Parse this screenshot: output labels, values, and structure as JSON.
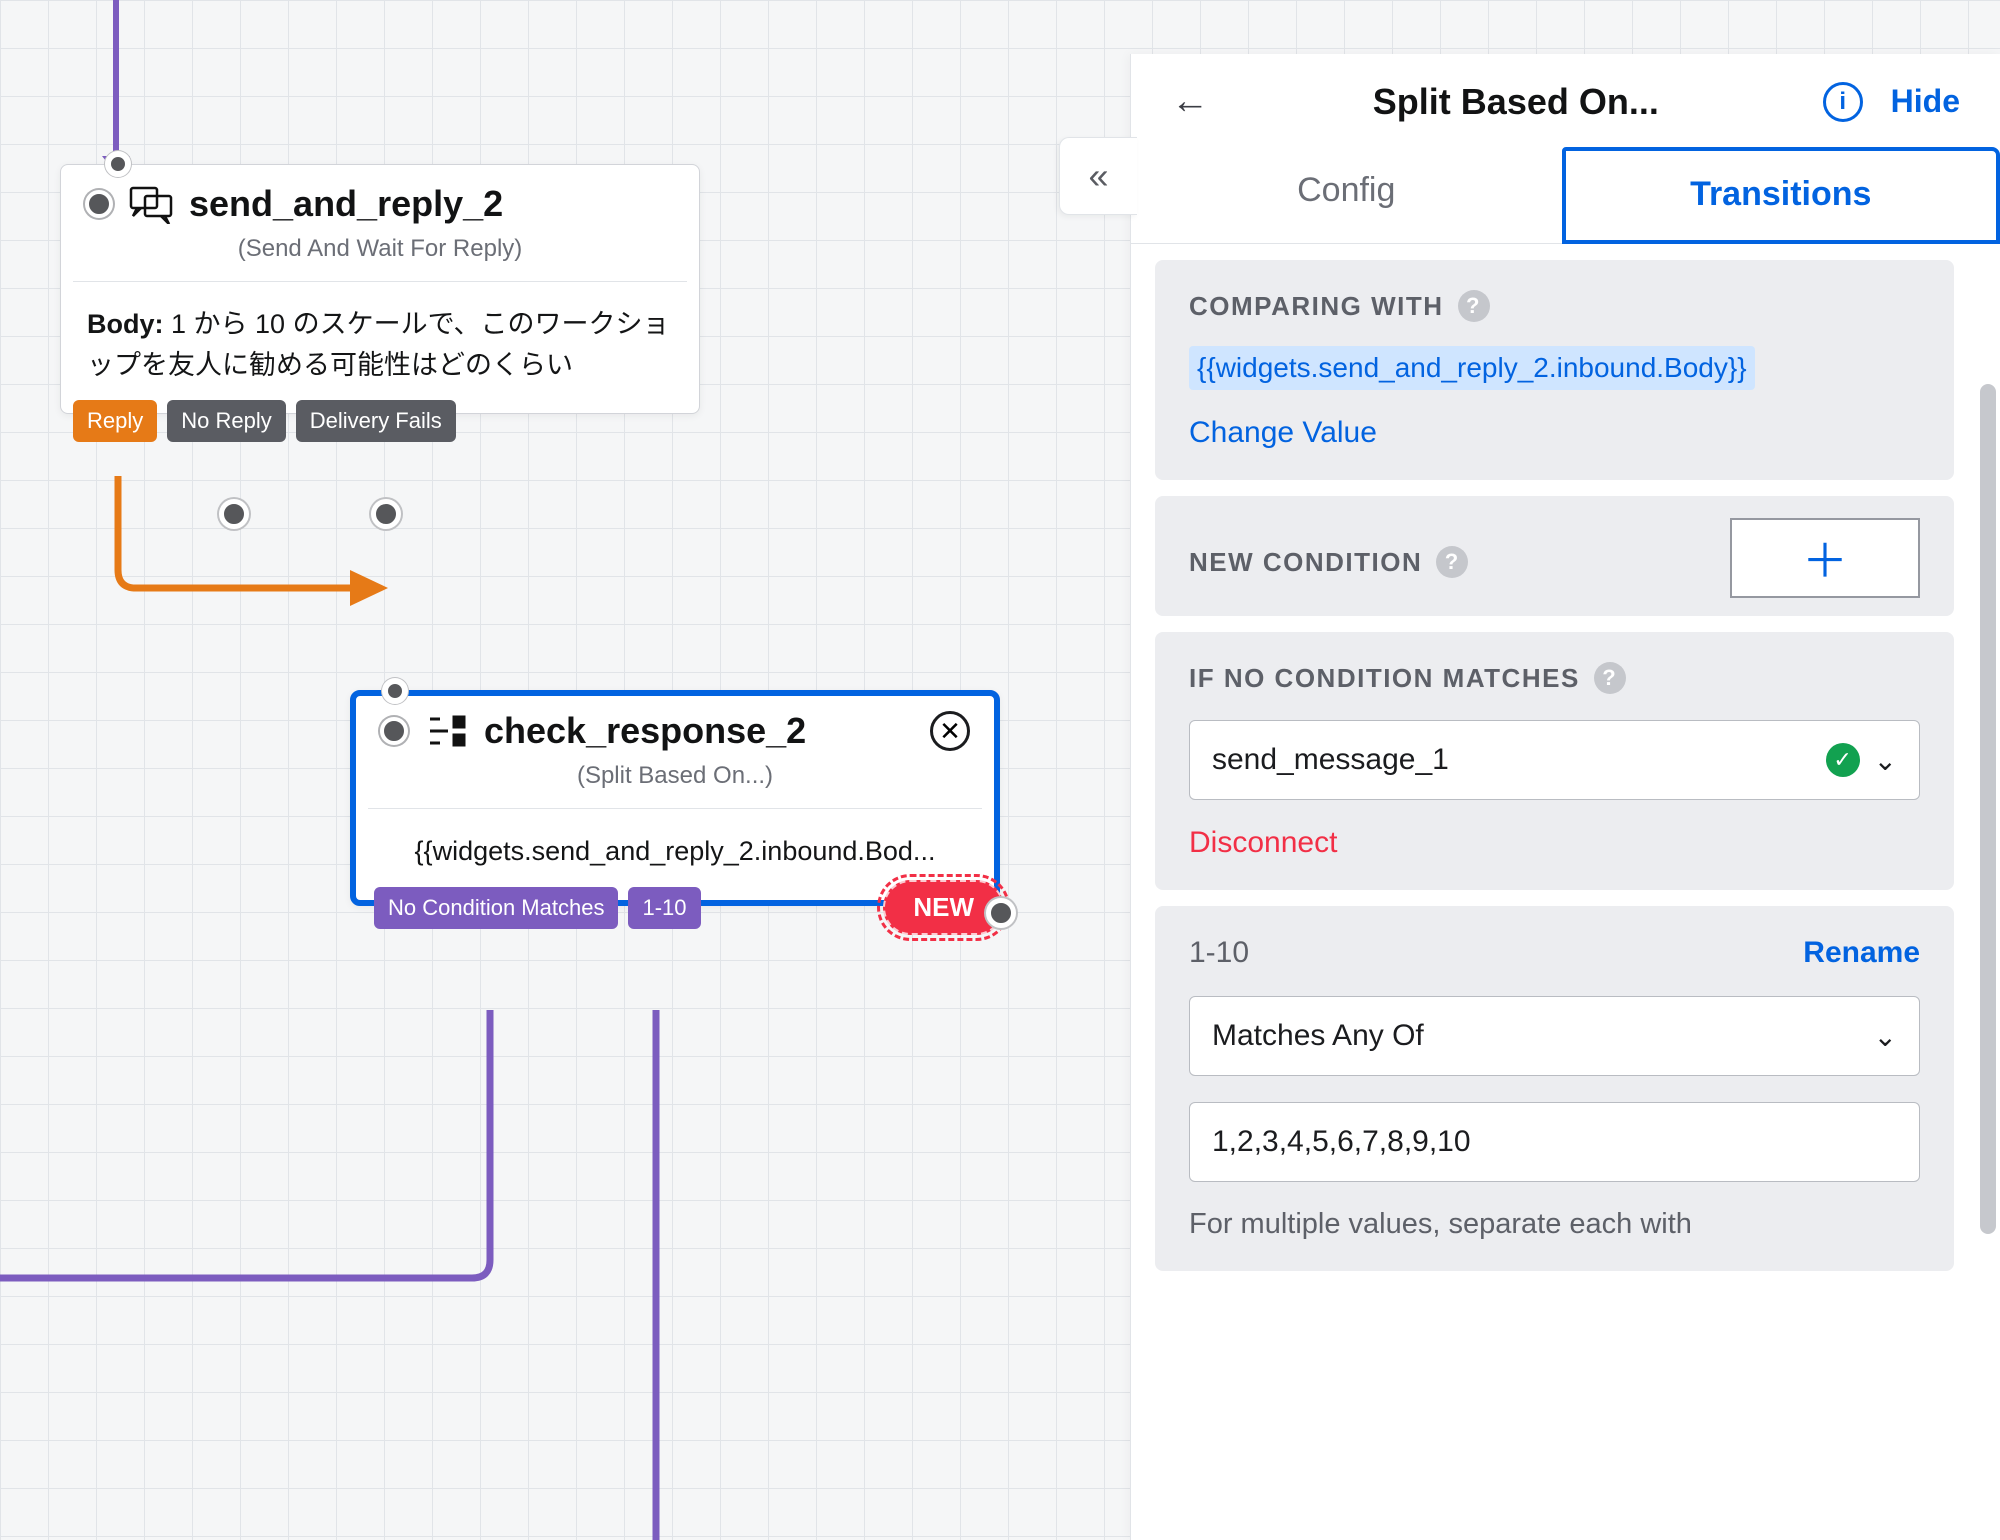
{
  "nodes": {
    "send": {
      "title": "send_and_reply_2",
      "subtitle": "(Send And Wait For Reply)",
      "body_label": "Body:",
      "body_text": "1 から 10 のスケールで、このワークショップを友人に勧める可能性はどのくらい",
      "outcomes": {
        "reply": "Reply",
        "no_reply": "No Reply",
        "delivery_fails": "Delivery Fails"
      }
    },
    "check": {
      "title": "check_response_2",
      "subtitle": "(Split Based On...)",
      "body_text": "{{widgets.send_and_reply_2.inbound.Bod...",
      "outcomes": {
        "no_match": "No Condition Matches",
        "range": "1-10",
        "new": "NEW"
      }
    }
  },
  "sidebar": {
    "title": "Split Based On...",
    "hide": "Hide",
    "tabs": {
      "config": "Config",
      "transitions": "Transitions"
    },
    "comparing": {
      "label": "COMPARING WITH",
      "value": "{{widgets.send_and_reply_2.inbound.Body}}",
      "change": "Change Value"
    },
    "new_condition": {
      "label": "NEW CONDITION"
    },
    "no_match": {
      "label": "IF NO CONDITION MATCHES",
      "select_value": "send_message_1",
      "disconnect": "Disconnect"
    },
    "condition1": {
      "title": "1-10",
      "rename": "Rename",
      "op": "Matches Any Of",
      "value": "1,2,3,4,5,6,7,8,9,10",
      "help": "For multiple values, separate each with"
    }
  }
}
